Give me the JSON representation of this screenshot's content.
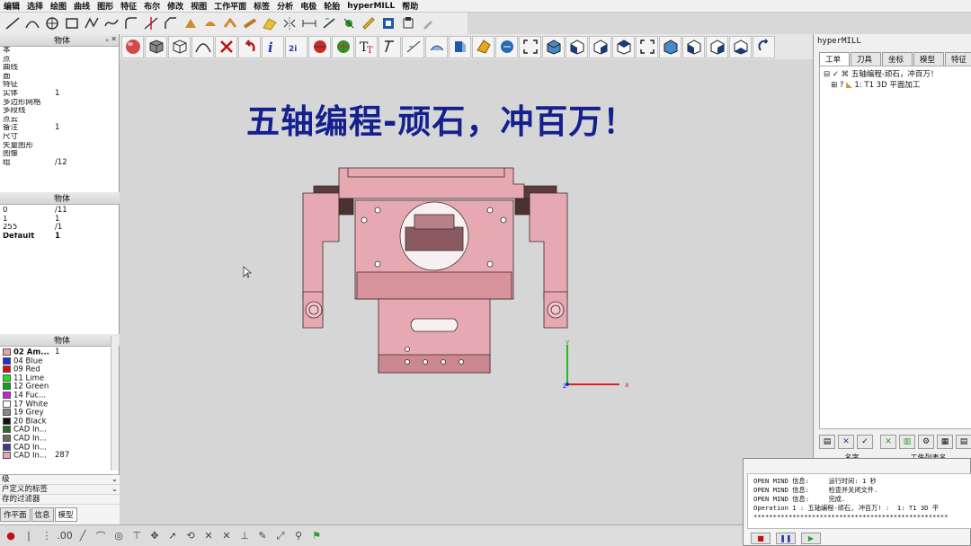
{
  "menu": [
    "编辑",
    "选择",
    "绘图",
    "曲线",
    "图形",
    "特征",
    "布尔",
    "修改",
    "视图",
    "工作平面",
    "标签",
    "分析",
    "电极",
    "轮胎",
    "hyperMILL",
    "帮助"
  ],
  "overlay_title": "五轴编程-顽石，冲百万！",
  "left_panel": {
    "header1_col": "物体",
    "rows1": [
      {
        "name": "本",
        "val": ""
      },
      {
        "name": "点",
        "val": ""
      },
      {
        "name": "曲线",
        "val": ""
      },
      {
        "name": "面",
        "val": ""
      },
      {
        "name": "特征",
        "val": ""
      },
      {
        "name": "实体",
        "val": "1"
      },
      {
        "name": "多边形网格",
        "val": ""
      },
      {
        "name": "多段线",
        "val": ""
      },
      {
        "name": "点云",
        "val": ""
      },
      {
        "name": "备注",
        "val": "1"
      },
      {
        "name": "尺寸",
        "val": ""
      },
      {
        "name": "矢量图形",
        "val": ""
      },
      {
        "name": "图像",
        "val": ""
      },
      {
        "name": "组",
        "val": "/12"
      }
    ],
    "header2_col": "物体",
    "rows2": [
      {
        "name": "0",
        "val": "/11"
      },
      {
        "name": "1",
        "val": "1"
      },
      {
        "name": "255",
        "val": "/1"
      },
      {
        "name": "Default",
        "val": "1"
      }
    ],
    "header3_col": "物体",
    "colors": [
      {
        "name": "02 Am...",
        "val": "1",
        "color": "#e8a3b0",
        "bold": true
      },
      {
        "name": "04 Blue",
        "val": "",
        "color": "#1f2fd0"
      },
      {
        "name": "09 Red",
        "val": "",
        "color": "#d01010"
      },
      {
        "name": "11 Lime",
        "val": "",
        "color": "#20e020"
      },
      {
        "name": "12 Green",
        "val": "",
        "color": "#10a020"
      },
      {
        "name": "14 Fuc...",
        "val": "",
        "color": "#d020d0"
      },
      {
        "name": "17 White",
        "val": "",
        "color": "#ffffff"
      },
      {
        "name": "19 Grey",
        "val": "",
        "color": "#888888"
      },
      {
        "name": "20 Black",
        "val": "",
        "color": "#111111"
      },
      {
        "name": "CAD In...",
        "val": "",
        "color": "#2a6a2a"
      },
      {
        "name": "CAD In...",
        "val": "",
        "color": "#6a6a6a"
      },
      {
        "name": "CAD In...",
        "val": "",
        "color": "#3a3a8a"
      },
      {
        "name": "CAD In...",
        "val": "287",
        "color": "#e8a3b0"
      }
    ],
    "bottom_rows": [
      "级",
      "户定义的标签",
      "存的过滤器"
    ],
    "tabs": [
      "作平面",
      "信息",
      "模型"
    ]
  },
  "right_panel": {
    "title": "hyperMILL",
    "tabs": [
      "工单",
      "刀具",
      "坐标",
      "模型",
      "特征"
    ],
    "tree": [
      "五轴编程-顽石，冲百万！",
      "1: T1 3D 平面加工"
    ],
    "cols": [
      "名字",
      "",
      "工件列表名"
    ]
  },
  "console": {
    "lines": [
      "OPEN MIND 信息:     运行时间: 1 秒",
      "OPEN MIND 信息:     检查并关闭文件.",
      "OPEN MIND 信息:     完成.",
      "Operation 1 : 五轴编程-顽石, 冲百万! :  1: T1 3D 平",
      "**************************************************"
    ]
  },
  "axis": {
    "x": "x",
    "y": "y",
    "z": "z"
  },
  "colors": {
    "accent": "#15208f",
    "part_pink": "#e8a3b0",
    "viewport_bg": "#d6d6d6"
  }
}
